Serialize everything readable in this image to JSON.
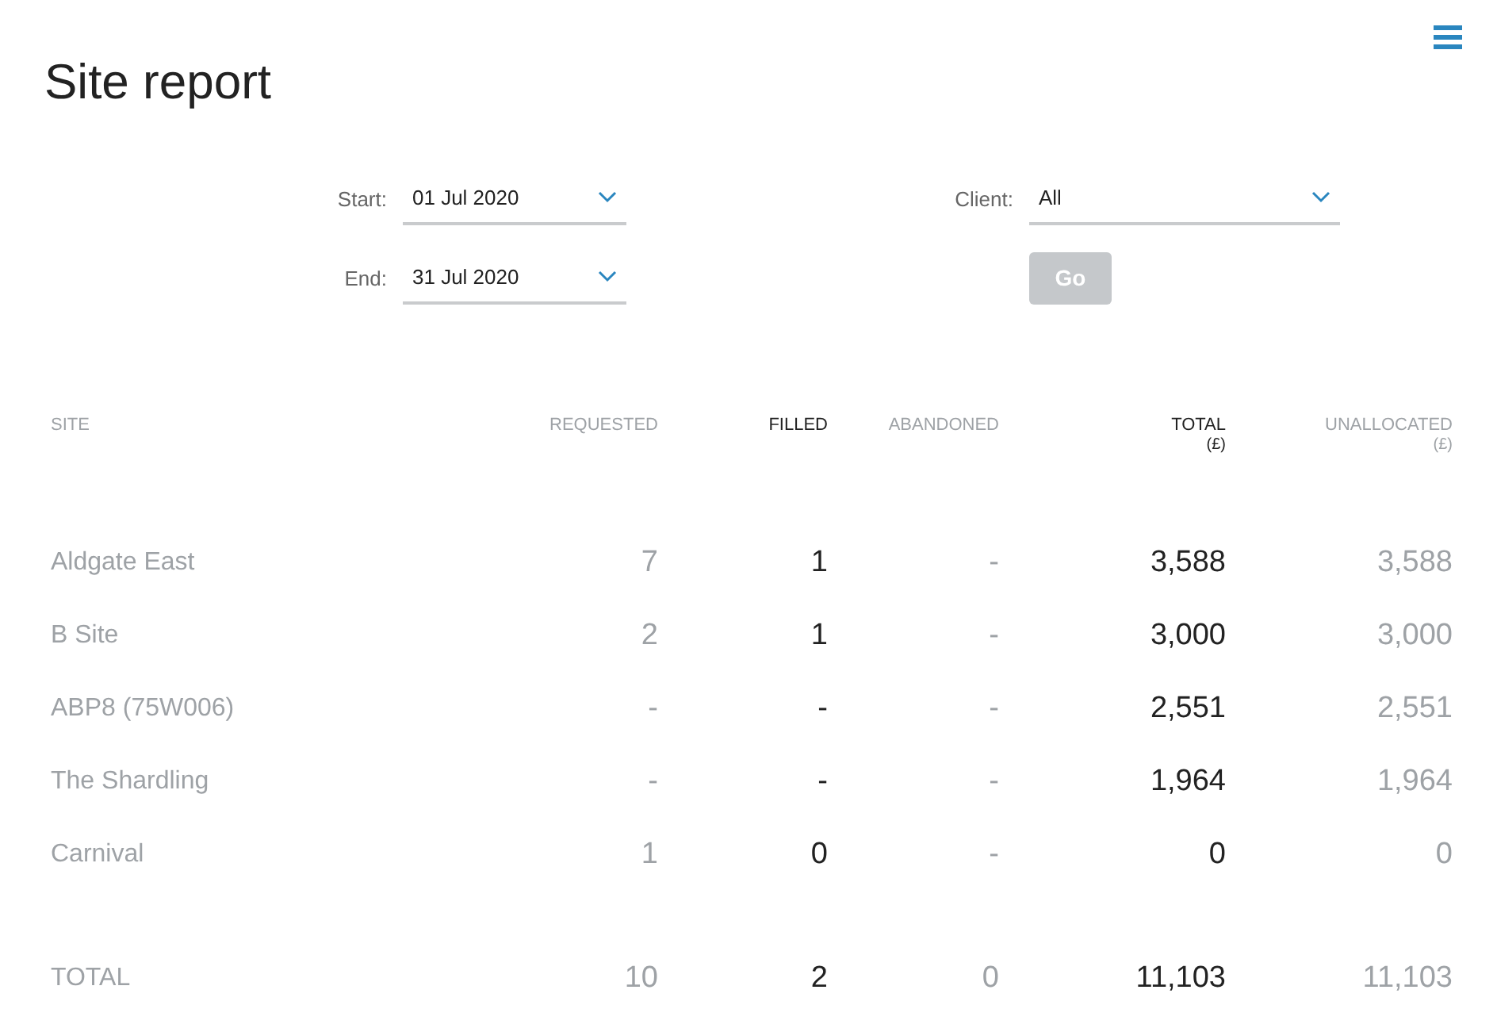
{
  "title": "Site report",
  "filters": [
    {
      "label": "Start:",
      "value": "01 Jul 2020"
    },
    {
      "label": "Client:",
      "value": "All"
    },
    {
      "label": "End:",
      "value": "31 Jul 2020"
    }
  ],
  "go_button": {
    "label": "Go",
    "disabled": true
  },
  "table": {
    "columns": [
      {
        "label": "SITE",
        "kind": "muted"
      },
      {
        "label": "REQUESTED",
        "kind": "muted"
      },
      {
        "label": "FILLED",
        "kind": "strong"
      },
      {
        "label": "ABANDONED",
        "kind": "muted"
      },
      {
        "label": "TOTAL",
        "unit": "(£)",
        "kind": "strong"
      },
      {
        "label": "UNALLOCATED",
        "unit": "(£)",
        "kind": "muted"
      }
    ],
    "rows": [
      [
        "Aldgate East",
        "7",
        "1",
        "-",
        "3,588",
        "3,588"
      ],
      [
        "B Site",
        "2",
        "1",
        "-",
        "3,000",
        "3,000"
      ],
      [
        "ABP8 (75W006)",
        "-",
        "-",
        "-",
        "2,551",
        "2,551"
      ],
      [
        "The Shardling",
        "-",
        "-",
        "-",
        "1,964",
        "1,964"
      ],
      [
        "Carnival",
        "1",
        "0",
        "-",
        "0",
        "0"
      ]
    ],
    "total_row": [
      "TOTAL",
      "10",
      "2",
      "0",
      "11,103",
      "11,103"
    ]
  }
}
